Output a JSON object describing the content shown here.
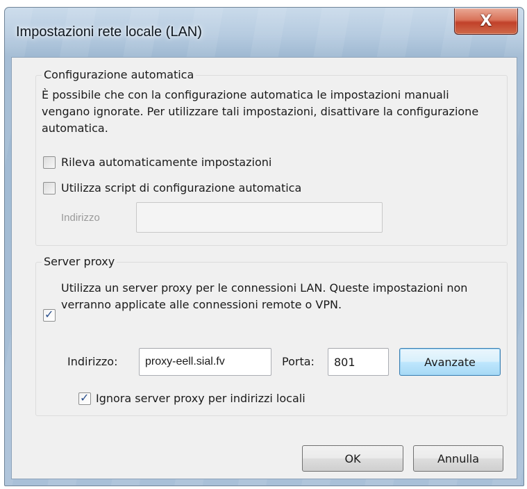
{
  "window": {
    "title": "Impostazioni rete locale (LAN)",
    "close_symbol": "X"
  },
  "auto_config": {
    "group_label": "Configurazione automatica",
    "description": "È possibile che con la configurazione automatica le impostazioni manuali vengano ignorate. Per utilizzare tali impostazioni, disattivare la configurazione automatica.",
    "detect_settings": {
      "label": "Rileva automaticamente impostazioni",
      "checked": false
    },
    "use_script": {
      "label": "Utilizza script di configurazione automatica",
      "checked": false
    },
    "address_label": "Indirizzo",
    "address_value": ""
  },
  "proxy": {
    "group_label": "Server proxy",
    "use_proxy": {
      "label": "Utilizza un server proxy per le connessioni LAN. Queste impostazioni non verranno applicate alle connessioni remote o VPN.",
      "checked": true
    },
    "address_label": "Indirizzo:",
    "address_value": "proxy-eell.sial.fv",
    "port_label": "Porta:",
    "port_value": "801",
    "advanced_label": "Avanzate",
    "bypass_local": {
      "label": "Ignora server proxy per indirizzi locali",
      "checked": true
    }
  },
  "buttons": {
    "ok_label": "OK",
    "cancel_label": "Annulla"
  },
  "icons": {
    "check_symbol": "✓"
  }
}
